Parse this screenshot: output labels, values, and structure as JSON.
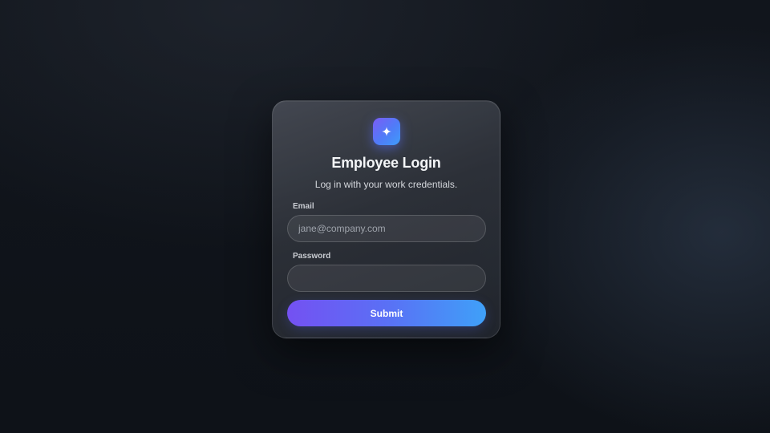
{
  "login": {
    "logo_icon": "sparkle-icon",
    "title": "Employee Login",
    "subtitle": "Log in with your work credentials.",
    "email": {
      "label": "Email",
      "value": "",
      "placeholder": "jane@company.com"
    },
    "password": {
      "label": "Password",
      "value": "",
      "placeholder": ""
    },
    "submit_label": "Submit"
  },
  "colors": {
    "background": "#10141a",
    "accent_start": "#7451f2",
    "accent_end": "#3fa0f8",
    "text_primary": "#f4f6f8"
  }
}
